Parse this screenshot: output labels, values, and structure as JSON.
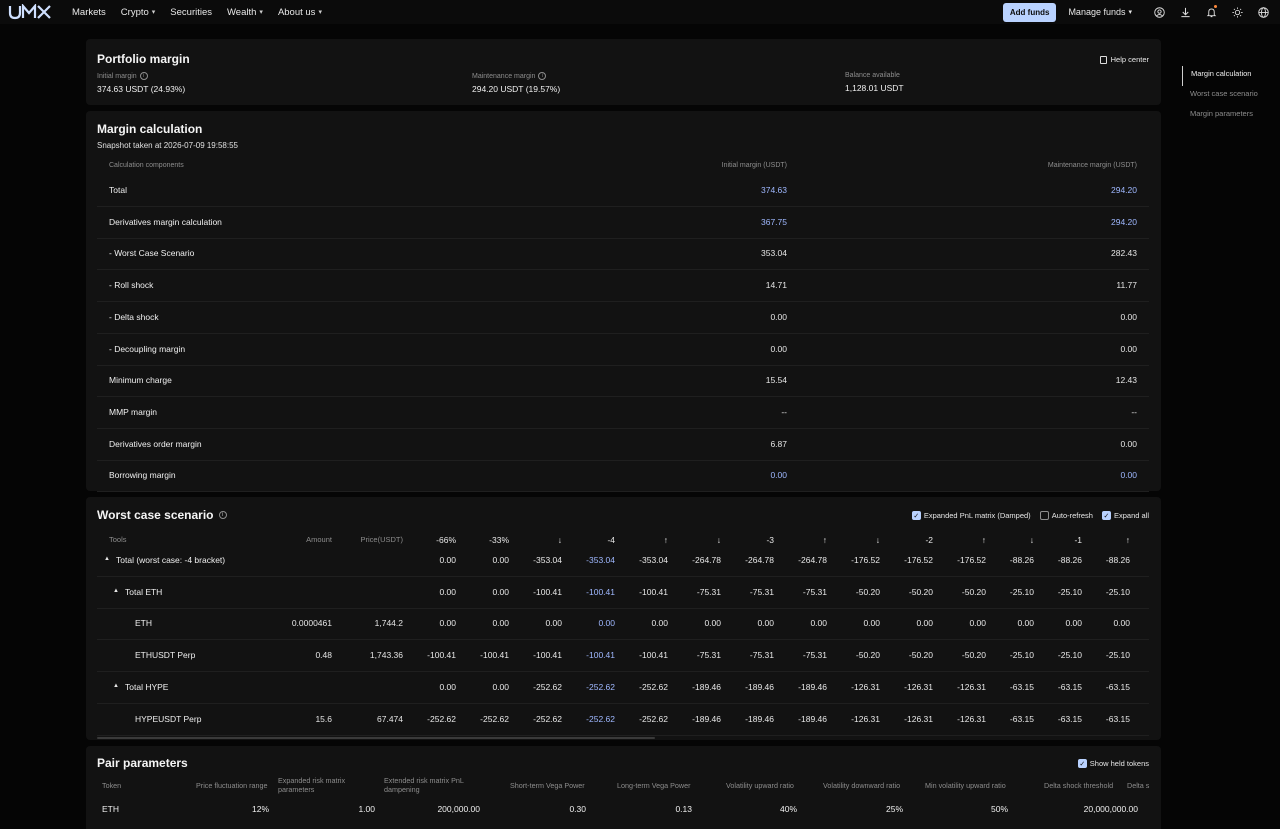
{
  "nav": {
    "logo_alt": "UMX",
    "items": [
      "Markets",
      "Crypto",
      "Securities",
      "Wealth",
      "About us"
    ],
    "add_funds": "Add funds",
    "manage_funds": "Manage funds"
  },
  "toc": {
    "items": [
      "Margin calculation",
      "Worst case scenario",
      "Margin parameters"
    ],
    "active": 0
  },
  "portfolio": {
    "title": "Portfolio margin",
    "help": "Help center",
    "initial_label": "Initial margin",
    "initial_value": "374.63 USDT (24.93%)",
    "maint_label": "Maintenance margin",
    "maint_value": "294.20 USDT (19.57%)",
    "balance_label": "Balance available",
    "balance_value": "1,128.01 USDT"
  },
  "margin_calc": {
    "title": "Margin calculation",
    "snapshot": "Snapshot taken at 2026-07-09 19:58:55",
    "headers": [
      "Calculation components",
      "Initial margin (USDT)",
      "Maintenance margin (USDT)"
    ],
    "rows": [
      {
        "label": "Total",
        "initial": "374.63",
        "maint": "294.20",
        "highlight": true
      },
      {
        "label": "Derivatives margin calculation",
        "initial": "367.75",
        "maint": "294.20",
        "highlight": true
      },
      {
        "label": "- Worst Case Scenario",
        "initial": "353.04",
        "maint": "282.43",
        "highlight": false
      },
      {
        "label": "- Roll shock",
        "initial": "14.71",
        "maint": "11.77",
        "highlight": false
      },
      {
        "label": "- Delta shock",
        "initial": "0.00",
        "maint": "0.00",
        "highlight": false
      },
      {
        "label": "- Decoupling margin",
        "initial": "0.00",
        "maint": "0.00",
        "highlight": false
      },
      {
        "label": "Minimum charge",
        "initial": "15.54",
        "maint": "12.43",
        "highlight": false
      },
      {
        "label": "MMP margin",
        "initial": "--",
        "maint": "--",
        "highlight": false
      },
      {
        "label": "Derivatives order margin",
        "initial": "6.87",
        "maint": "0.00",
        "highlight": false
      },
      {
        "label": "Borrowing margin",
        "initial": "0.00",
        "maint": "0.00",
        "highlight": true
      }
    ]
  },
  "worst_case": {
    "title": "Worst case scenario",
    "options": [
      {
        "label": "Expanded PnL matrix (Damped)",
        "checked": true
      },
      {
        "label": "Auto-refresh",
        "checked": false
      },
      {
        "label": "Expand all",
        "checked": true
      }
    ],
    "headers": [
      "Tools",
      "Amount",
      "Price(USDT)",
      "-66%",
      "-33%",
      "↓",
      "-4",
      "↑",
      "↓",
      "-3",
      "↑",
      "↓",
      "-2",
      "↑",
      "↓",
      "-1",
      "↑"
    ],
    "rows": [
      {
        "label": "Total (worst case: -4 bracket)",
        "indent": 0,
        "caret": true,
        "amount": "",
        "price": "",
        "values": [
          "0.00",
          "0.00",
          "-353.04",
          "-353.04",
          "-353.04",
          "-264.78",
          "-264.78",
          "-264.78",
          "-176.52",
          "-176.52",
          "-176.52",
          "-88.26",
          "-88.26",
          "-88.26"
        ]
      },
      {
        "label": "Total ETH",
        "indent": 1,
        "caret": true,
        "amount": "",
        "price": "",
        "values": [
          "0.00",
          "0.00",
          "-100.41",
          "-100.41",
          "-100.41",
          "-75.31",
          "-75.31",
          "-75.31",
          "-50.20",
          "-50.20",
          "-50.20",
          "-25.10",
          "-25.10",
          "-25.10"
        ]
      },
      {
        "label": "ETH",
        "indent": 2,
        "caret": false,
        "amount": "0.0000461",
        "price": "1,744.2",
        "values": [
          "0.00",
          "0.00",
          "0.00",
          "0.00",
          "0.00",
          "0.00",
          "0.00",
          "0.00",
          "0.00",
          "0.00",
          "0.00",
          "0.00",
          "0.00",
          "0.00"
        ]
      },
      {
        "label": "ETHUSDT Perp",
        "indent": 2,
        "caret": false,
        "amount": "0.48",
        "price": "1,743.36",
        "values": [
          "-100.41",
          "-100.41",
          "-100.41",
          "-100.41",
          "-100.41",
          "-75.31",
          "-75.31",
          "-75.31",
          "-50.20",
          "-50.20",
          "-50.20",
          "-25.10",
          "-25.10",
          "-25.10"
        ]
      },
      {
        "label": "Total HYPE",
        "indent": 1,
        "caret": true,
        "amount": "",
        "price": "",
        "values": [
          "0.00",
          "0.00",
          "-252.62",
          "-252.62",
          "-252.62",
          "-189.46",
          "-189.46",
          "-189.46",
          "-126.31",
          "-126.31",
          "-126.31",
          "-63.15",
          "-63.15",
          "-63.15"
        ]
      },
      {
        "label": "HYPEUSDT Perp",
        "indent": 2,
        "caret": false,
        "amount": "15.6",
        "price": "67.474",
        "values": [
          "-252.62",
          "-252.62",
          "-252.62",
          "-252.62",
          "-252.62",
          "-189.46",
          "-189.46",
          "-189.46",
          "-126.31",
          "-126.31",
          "-126.31",
          "-63.15",
          "-63.15",
          "-63.15"
        ]
      }
    ]
  },
  "pair_params": {
    "title": "Pair parameters",
    "show_held": "Show held tokens",
    "headers": [
      "Token",
      "Price fluctuation range",
      "Expanded risk matrix parameters",
      "Extended risk matrix PnL dampening",
      "Short-term Vega Power",
      "Long-term Vega Power",
      "Volatility upward ratio",
      "Volatility downward ratio",
      "Min volatility upward ratio",
      "Delta shock threshold",
      "Delta s"
    ],
    "row": [
      "ETH",
      "12%",
      "1.00",
      "200,000.00",
      "0.30",
      "0.13",
      "40%",
      "25%",
      "50%",
      "20,000,000.00"
    ]
  },
  "colors": {
    "accent": "#9fb8ff",
    "button": "#b9d2ff",
    "panel": "#121212",
    "background": "#050505"
  }
}
